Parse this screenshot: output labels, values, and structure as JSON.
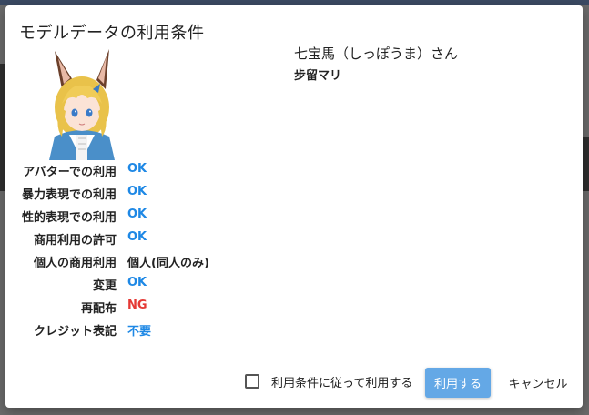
{
  "dialog": {
    "title": "モデルデータの利用条件",
    "model_name": "七宝馬（しっぽうま）さん",
    "author": "步留マリ"
  },
  "terms": [
    {
      "label": "アバターでの利用",
      "value": "OK",
      "status": "ok"
    },
    {
      "label": "暴力表現での利用",
      "value": "OK",
      "status": "ok"
    },
    {
      "label": "性的表現での利用",
      "value": "OK",
      "status": "ok"
    },
    {
      "label": "商用利用の許可",
      "value": "OK",
      "status": "ok"
    },
    {
      "label": "個人の商用利用",
      "value": "個人(同人のみ)",
      "status": "plain"
    },
    {
      "label": "変更",
      "value": "OK",
      "status": "ok"
    },
    {
      "label": "再配布",
      "value": "NG",
      "status": "ng"
    },
    {
      "label": "クレジット表記",
      "value": "不要",
      "status": "ok"
    }
  ],
  "footer": {
    "agree_label": "利用条件に従って利用する",
    "agree_checked": false,
    "use_label": "利用する",
    "cancel_label": "キャンセル"
  },
  "colors": {
    "ok": "#1e88e5",
    "ng": "#e53935",
    "primary_button": "#64a8e6"
  }
}
